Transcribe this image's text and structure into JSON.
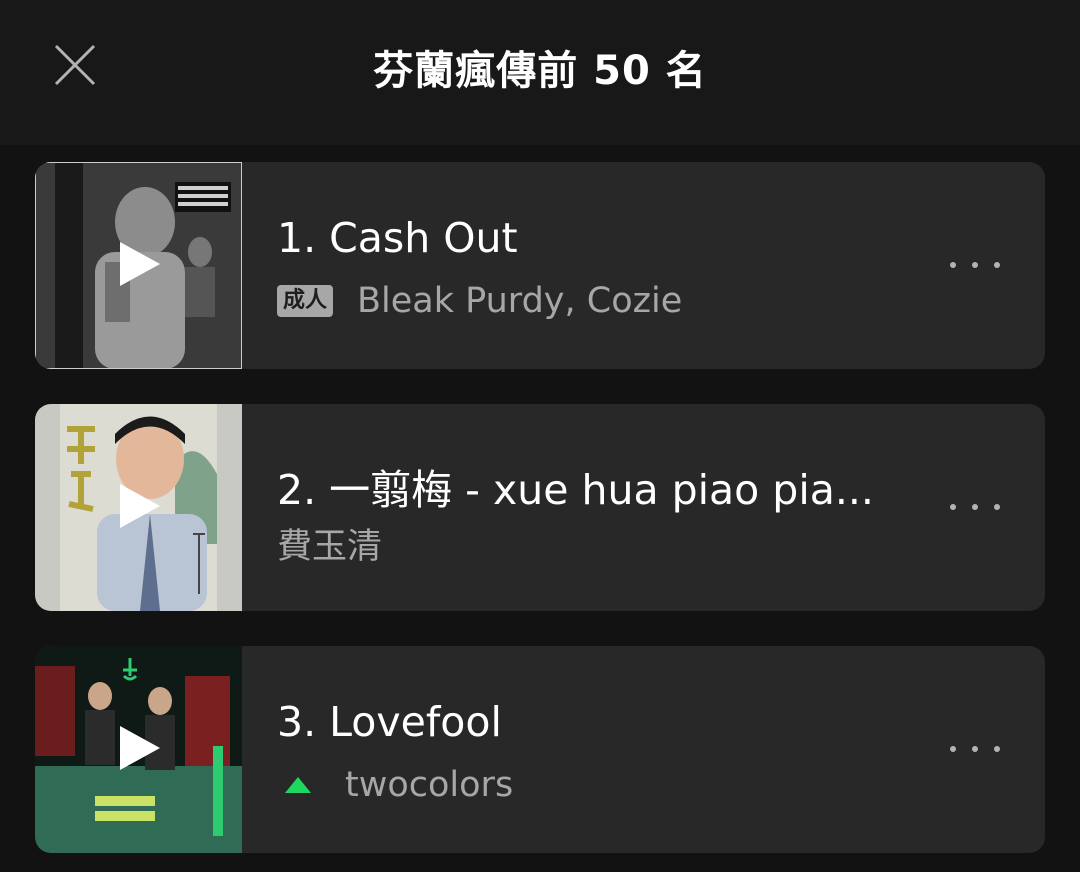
{
  "header": {
    "title": "芬蘭瘋傳前 50 名",
    "close_icon": "close-icon"
  },
  "tracks": [
    {
      "title": "1. Cash Out",
      "badge": "成人",
      "artist": "Bleak Purdy, Cozie",
      "trend": "",
      "cover_icon": "album-cover",
      "play_icon": "play-icon",
      "more_icon": "more-options-icon"
    },
    {
      "title": "2. 一翦梅 - xue hua piao pia...",
      "badge": "",
      "artist": "費玉清",
      "trend": "",
      "cover_icon": "album-cover",
      "play_icon": "play-icon",
      "more_icon": "more-options-icon"
    },
    {
      "title": "3. Lovefool",
      "badge": "",
      "artist": "twocolors",
      "trend": "up",
      "cover_icon": "album-cover",
      "play_icon": "play-icon",
      "more_icon": "more-options-icon"
    }
  ],
  "colors": {
    "background": "#121212",
    "header_bg": "#181818",
    "card_bg": "#282828",
    "secondary_text": "#a7a7a7",
    "trend_up": "#1ed760"
  }
}
